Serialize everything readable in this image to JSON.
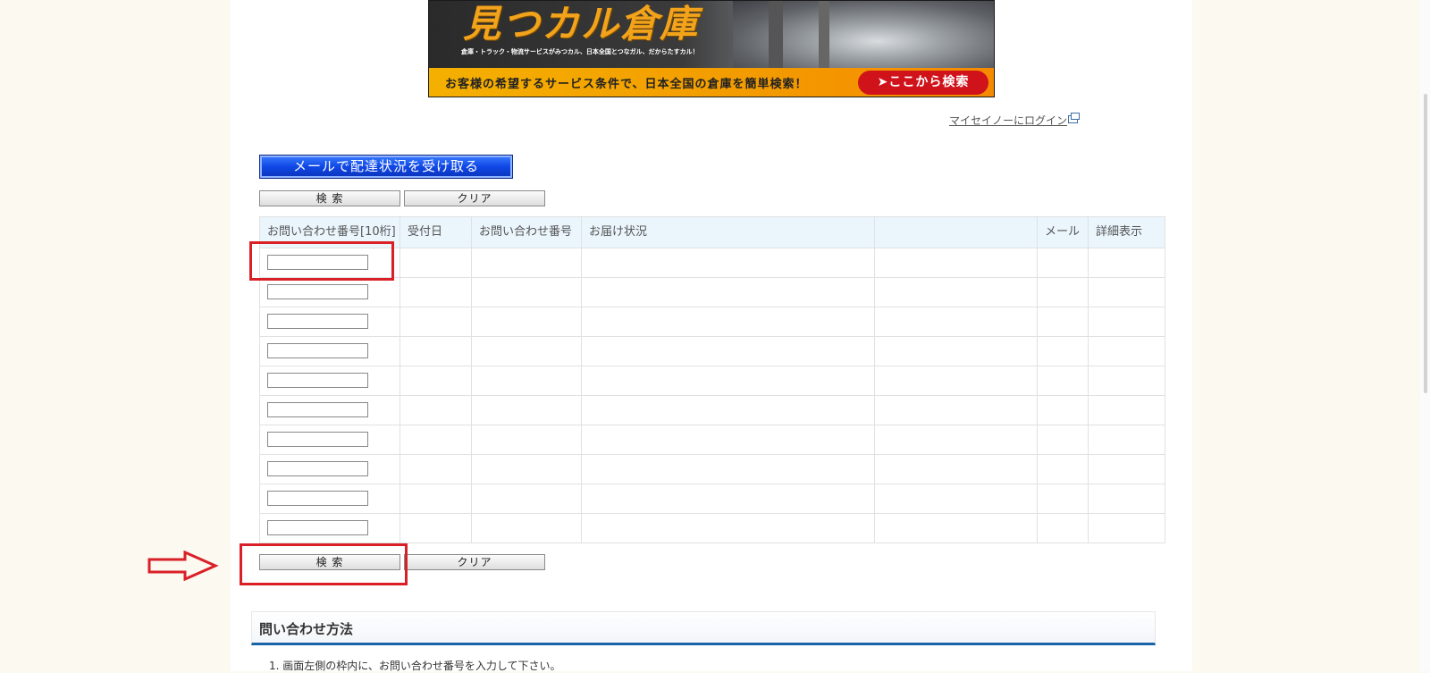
{
  "banner": {
    "logo_text": "見つカル倉庫",
    "tagline": "倉庫・トラック・物流サービスがみつカル、日本全国とつなガル、だからたすカル！",
    "strip_text": "お客様の希望するサービス条件で、日本全国の倉庫を簡単検索！",
    "cta_label": "➤ここから検索"
  },
  "login_link": "マイセイノーにログイン",
  "mail_button": "メールで配達状況を受け取る",
  "top_actions": {
    "search": "検 索",
    "clear": "クリア"
  },
  "bottom_actions": {
    "search": "検 索",
    "clear": "クリア"
  },
  "table": {
    "headers": [
      "お問い合わせ番号[10桁]",
      "受付日",
      "お問い合わせ番号",
      "お届け状況",
      "",
      "メール",
      "詳細表示"
    ],
    "inquiry_inputs": [
      "",
      "",
      "",
      "",
      "",
      "",
      "",
      "",
      "",
      ""
    ]
  },
  "section": {
    "title": "問い合わせ方法",
    "instruction": "1. 画面左側の枠内に、お問い合わせ番号を入力して下さい。"
  },
  "colors": {
    "page_bg": "#fcf9f0",
    "header_bg": "#eaf5fc",
    "mail_button": "#1048e6",
    "annotation_red": "#d92027",
    "section_rule": "#1a63a8"
  }
}
